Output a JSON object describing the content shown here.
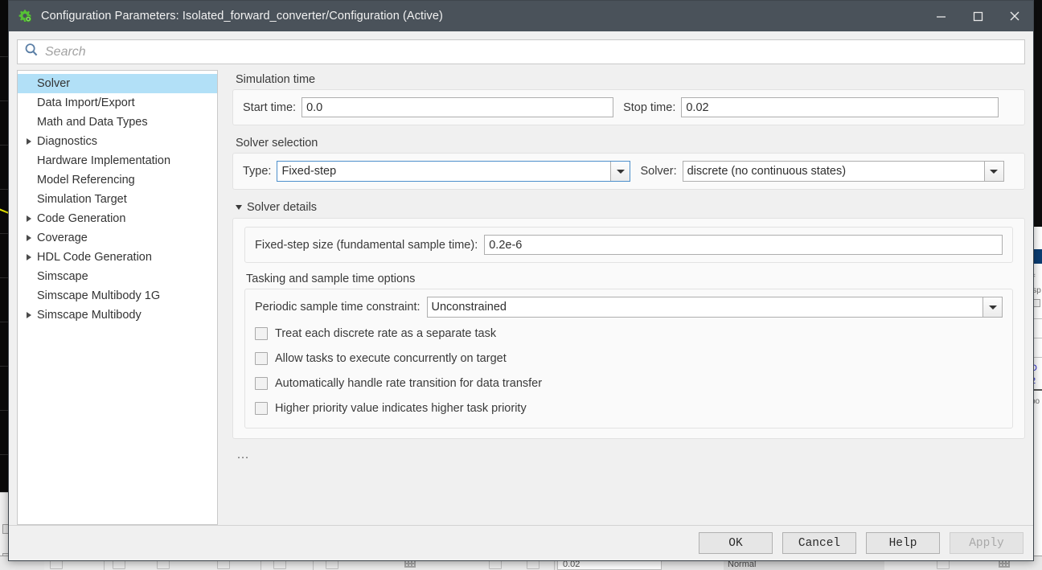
{
  "window": {
    "title": "Configuration Parameters: Isolated_forward_converter/Configuration (Active)",
    "icon": "simulink-gear-icon",
    "controls": {
      "minimize": "—",
      "maximize": "❐",
      "close": "✕"
    }
  },
  "search": {
    "placeholder": "Search",
    "value": "",
    "icon": "search-icon"
  },
  "sidebar": {
    "items": [
      {
        "label": "Solver",
        "expandable": false,
        "selected": true
      },
      {
        "label": "Data Import/Export",
        "expandable": false,
        "selected": false
      },
      {
        "label": "Math and Data Types",
        "expandable": false,
        "selected": false
      },
      {
        "label": "Diagnostics",
        "expandable": true,
        "selected": false
      },
      {
        "label": "Hardware Implementation",
        "expandable": false,
        "selected": false
      },
      {
        "label": "Model Referencing",
        "expandable": false,
        "selected": false
      },
      {
        "label": "Simulation Target",
        "expandable": false,
        "selected": false
      },
      {
        "label": "Code Generation",
        "expandable": true,
        "selected": false
      },
      {
        "label": "Coverage",
        "expandable": true,
        "selected": false
      },
      {
        "label": "HDL Code Generation",
        "expandable": true,
        "selected": false
      },
      {
        "label": "Simscape",
        "expandable": false,
        "selected": false
      },
      {
        "label": "Simscape Multibody 1G",
        "expandable": false,
        "selected": false
      },
      {
        "label": "Simscape Multibody",
        "expandable": true,
        "selected": false
      }
    ]
  },
  "main": {
    "simulation_time": {
      "section_label": "Simulation time",
      "start_time_label": "Start time:",
      "start_time_value": "0.0",
      "stop_time_label": "Stop time:",
      "stop_time_value": "0.02"
    },
    "solver_selection": {
      "section_label": "Solver selection",
      "type_label": "Type:",
      "type_value": "Fixed-step",
      "solver_label": "Solver:",
      "solver_value": "discrete (no continuous states)"
    },
    "solver_details": {
      "header": "Solver details",
      "expanded": true,
      "fixed_step_label": "Fixed-step size (fundamental sample time):",
      "fixed_step_value": "0.2e-6",
      "tasking_label": "Tasking and sample time options",
      "periodic_label": "Periodic sample time constraint:",
      "periodic_value": "Unconstrained",
      "checkboxes": [
        {
          "label": "Treat each discrete rate as a separate task",
          "checked": false
        },
        {
          "label": "Allow tasks to execute concurrently on target",
          "checked": false
        },
        {
          "label": "Automatically handle rate transition for data transfer",
          "checked": false
        },
        {
          "label": "Higher priority value indicates higher task priority",
          "checked": false
        }
      ]
    },
    "overflow_indicator": "..."
  },
  "footer": {
    "buttons": [
      {
        "label": "OK",
        "disabled": false
      },
      {
        "label": "Cancel",
        "disabled": false
      },
      {
        "label": "Help",
        "disabled": false
      },
      {
        "label": "Apply",
        "disabled": true
      }
    ]
  },
  "background": {
    "toolbar_stop_time": "0.02",
    "toolbar_sim_mode": "Normal"
  },
  "colors": {
    "titlebar": "#4a525a",
    "selection": "#b2e0f7",
    "dialog_bg": "#f0f0f0",
    "groupbox_bg": "#fafafa",
    "field_border": "#aeaeae",
    "focus_border": "#4d8fcb"
  }
}
